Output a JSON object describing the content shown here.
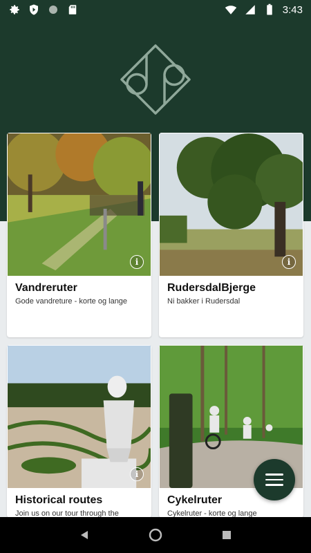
{
  "status_bar": {
    "time": "3:43",
    "left_icons": [
      "gear-icon",
      "shield-play-icon",
      "circle-icon",
      "sd-card-icon"
    ],
    "right_icons": [
      "wifi-icon",
      "signal-icon",
      "battery-icon"
    ]
  },
  "header": {
    "logo": "dp-diamond-logo",
    "colors": {
      "brand": "#1c3a2c",
      "background": "#e9ecee"
    }
  },
  "cards": [
    {
      "title": "Vandreruter",
      "subtitle": "Gode vandreture - korte og lange",
      "image": "hikers-on-autumn-path",
      "has_info": true
    },
    {
      "title": "RudersdalBjerge",
      "subtitle": "Ni bakker i Rudersdal",
      "image": "large-oak-tree-meadow",
      "has_info": true
    },
    {
      "title": "Historical routes",
      "subtitle": "Join us on our tour through the",
      "image": "statue-in-baroque-garden",
      "has_info": true
    },
    {
      "title": "Cykelruter",
      "subtitle": "Cykelruter - korte og lange",
      "image": "cyclists-on-forest-road",
      "has_info": false
    }
  ],
  "fab": {
    "icon": "menu-icon"
  },
  "nav_bar": {
    "buttons": [
      "back-icon",
      "home-icon",
      "recents-icon"
    ]
  }
}
